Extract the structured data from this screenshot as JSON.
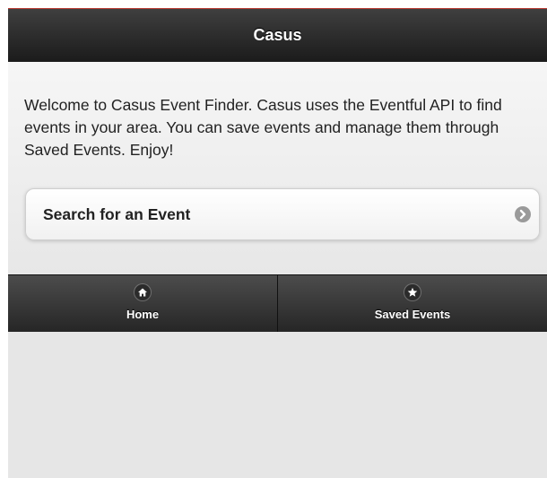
{
  "header": {
    "title": "Casus"
  },
  "main": {
    "intro_text": "Welcome to Casus Event Finder. Casus uses the Eventful API to find events in your area. You can save events and manage them through Saved Events. Enjoy!",
    "search_button": {
      "label": "Search for an Event",
      "icon": "arrow-right-icon"
    }
  },
  "navbar": {
    "items": [
      {
        "label": "Home",
        "icon": "home-icon"
      },
      {
        "label": "Saved Events",
        "icon": "star-icon"
      }
    ]
  },
  "colors": {
    "header_accent": "#b83a32",
    "bar_dark": "#1b1b1b",
    "page_bg": "#e9e9e9"
  }
}
